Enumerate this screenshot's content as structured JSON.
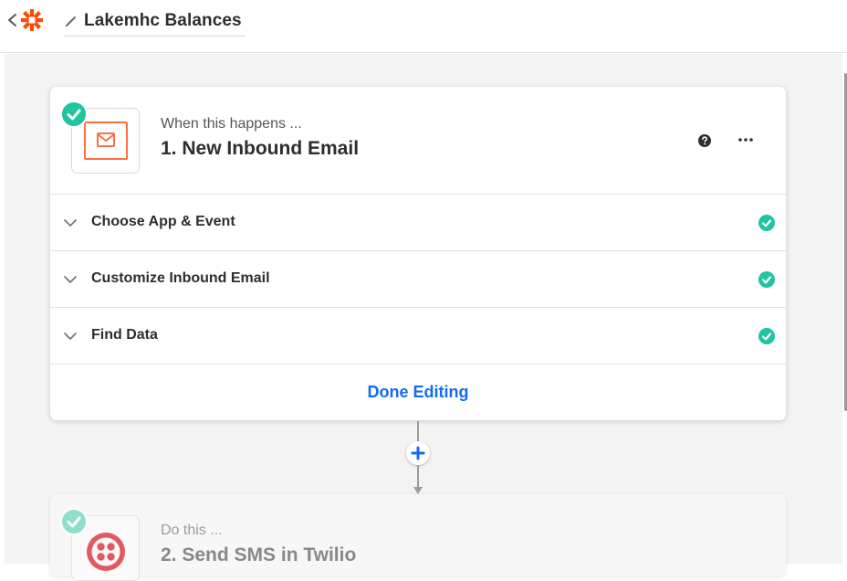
{
  "header": {
    "zap_title": "Lakemhc Balances"
  },
  "trigger_step": {
    "label": "When this happens ...",
    "title": "1. New Inbound Email",
    "sections": [
      {
        "label": "Choose App & Event",
        "status": "complete"
      },
      {
        "label": "Customize Inbound Email",
        "status": "complete"
      },
      {
        "label": "Find Data",
        "status": "complete"
      }
    ],
    "done_label": "Done Editing"
  },
  "action_step": {
    "label": "Do this ...",
    "title": "2. Send SMS in Twilio"
  },
  "colors": {
    "brand_orange": "#ff4a00",
    "check_green": "#20c5a0",
    "link_blue": "#136bf5",
    "email_orange": "#ff6e42",
    "twilio_red": "#e4585f"
  },
  "icons": {
    "back": "chevron-left-icon",
    "logo": "zapier-logo-icon",
    "edit": "pencil-icon",
    "email_app": "email-by-zapier-icon",
    "twilio_app": "twilio-icon",
    "help": "help-icon",
    "more": "more-horizontal-icon",
    "expand": "chevron-down-icon",
    "check": "check-circle-icon",
    "add": "plus-icon"
  }
}
